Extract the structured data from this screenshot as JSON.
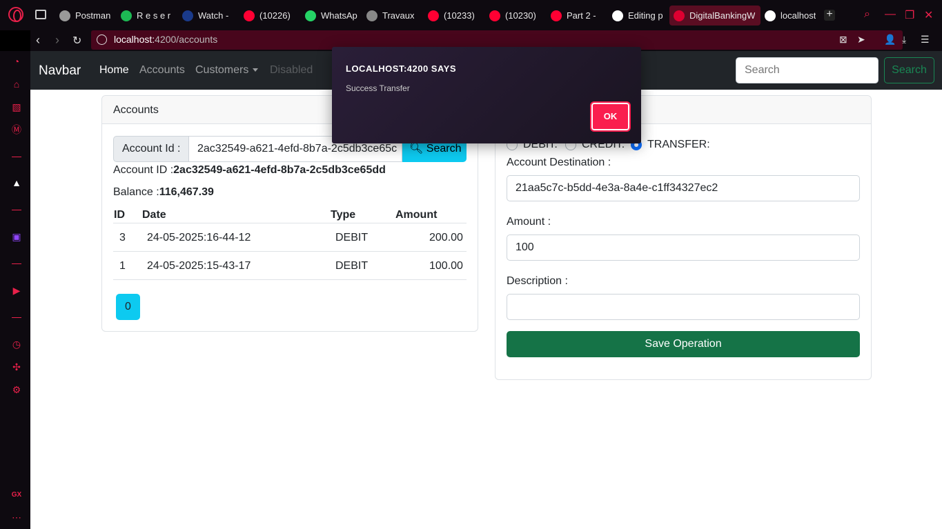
{
  "browser": {
    "tabs": [
      {
        "label": "Postman",
        "icon": "postman-icon",
        "color": "#999999"
      },
      {
        "label": "R e s e r",
        "icon": "spotify-icon",
        "color": "#1db954"
      },
      {
        "label": "Watch -",
        "icon": "disney-icon",
        "color": "#1a3a8a"
      },
      {
        "label": "(10226)",
        "icon": "youtube-icon",
        "color": "#ff0033"
      },
      {
        "label": "WhatsAp",
        "icon": "whatsapp-icon",
        "color": "#25d366"
      },
      {
        "label": "Travaux",
        "icon": "classroom-icon",
        "color": "#888888"
      },
      {
        "label": "(10233)",
        "icon": "youtube-icon",
        "color": "#ff0033"
      },
      {
        "label": "(10230)",
        "icon": "youtube-icon",
        "color": "#ff0033"
      },
      {
        "label": "Part 2 -",
        "icon": "youtube-icon",
        "color": "#ff0033"
      },
      {
        "label": "Editing p",
        "icon": "github-icon",
        "color": "#ffffff"
      },
      {
        "label": "DigitalBankingW",
        "icon": "angular-icon",
        "color": "#dd0031",
        "active": true
      },
      {
        "label": "localhost",
        "icon": "globe-icon",
        "color": "#ffffff"
      }
    ],
    "url_host": "localhost:",
    "url_rest": "4200/accounts",
    "accent": "#e8204a"
  },
  "navbar": {
    "brand": "Navbar",
    "links": [
      "Home",
      "Accounts",
      "Customers",
      "Disabled"
    ],
    "search_placeholder": "Search",
    "search_button": "Search"
  },
  "accounts": {
    "header": "Accounts",
    "id_label": "Account Id :",
    "id_value": "2ac32549-a621-4efd-8b7a-2c5db3ce65c",
    "search_button": "Search",
    "account_id_label": "Account ID :",
    "account_id_value": "2ac32549-a621-4efd-8b7a-2c5db3ce65dd",
    "balance_label": "Balance :",
    "balance_value": "116,467.39",
    "columns": [
      "ID",
      "Date",
      "Type",
      "Amount"
    ],
    "rows": [
      {
        "id": "3",
        "date": "24-05-2025:16-44-12",
        "type": "DEBIT",
        "amount": "200.00"
      },
      {
        "id": "1",
        "date": "24-05-2025:15-43-17",
        "type": "DEBIT",
        "amount": "100.00"
      }
    ],
    "page": "0"
  },
  "operations": {
    "radio_debit": "DEBIT:",
    "radio_credit": "CREDIT:",
    "radio_transfer": "TRANSFER:",
    "selected": "TRANSFER",
    "destination_label": "Account Destination :",
    "destination_value": "21aa5c7c-b5dd-4e3a-8a4e-c1ff34327ec2",
    "amount_label": "Amount :",
    "amount_value": "100",
    "description_label": "Description :",
    "description_value": "",
    "save_button": "Save Operation"
  },
  "dialog": {
    "title": "LOCALHOST:4200 SAYS",
    "message": "Success Transfer",
    "ok": "OK"
  },
  "sidebar_label": "GX"
}
